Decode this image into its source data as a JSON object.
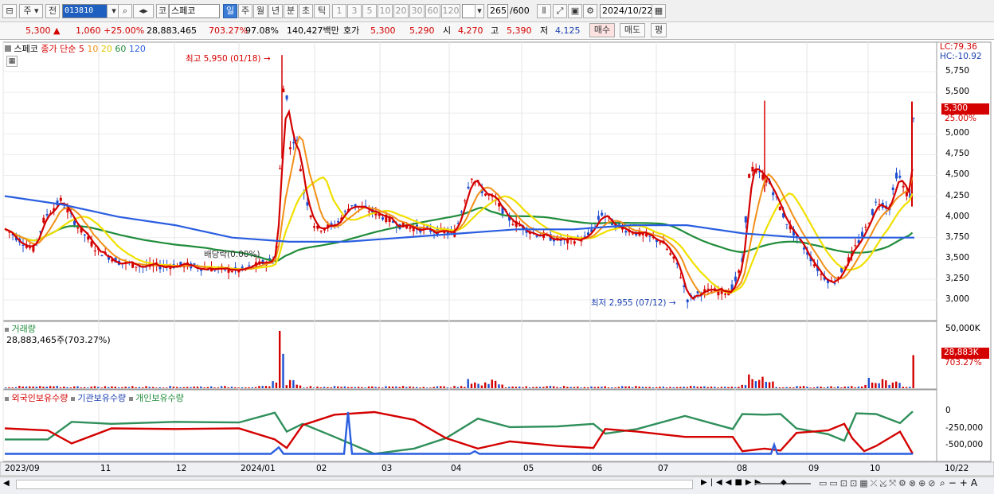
{
  "toolbar": {
    "market": "주",
    "prev_btn": "전",
    "code": "013810",
    "name_prefix": "코",
    "name": "스페코",
    "periods": [
      "일",
      "주",
      "월",
      "년",
      "분",
      "초",
      "틱"
    ],
    "minutes": [
      "1",
      "3",
      "5",
      "10",
      "20",
      "30",
      "60",
      "120"
    ],
    "count": "265",
    "count_max": "/600",
    "date": "2024/10/22"
  },
  "quote": {
    "price": "5,300",
    "change": "1,060",
    "change_pct": "+25.00%",
    "volume": "28,883,465",
    "vol_ratio": "703.27%",
    "strength": "97.08%",
    "amount": "140,427백만",
    "hoga_label": "호가",
    "ask": "5,300",
    "bid": "5,290",
    "open_label": "시",
    "open": "4,270",
    "high_label": "고",
    "high": "5,390",
    "low_label": "저",
    "low": "4,125",
    "buy_btn": "매수",
    "sell_btn": "매도",
    "eval_btn": "평"
  },
  "price_panel": {
    "title": "스페코",
    "legend": [
      {
        "label": "종가 단순",
        "color": "#d40000"
      },
      {
        "label": "5",
        "color": "#d40000"
      },
      {
        "label": "10",
        "color": "#f29018"
      },
      {
        "label": "20",
        "color": "#f0e000"
      },
      {
        "label": "60",
        "color": "#1f8c3a"
      },
      {
        "label": "120",
        "color": "#2a5ee0"
      }
    ],
    "lc": "LC:79.36",
    "hc": "HC:-10.92",
    "y_ticks": [
      "5,750",
      "5,500",
      "5,250",
      "5,000",
      "4,750",
      "4,500",
      "4,250",
      "4,000",
      "3,750",
      "3,500",
      "3,250",
      "3,000"
    ],
    "current_label": "5,300",
    "current_pct": "25.00%",
    "high_note": "최고 5,950 (01/18)",
    "low_note": "최저 2,955 (07/12)",
    "dividend_note": "배당락(0.00%)"
  },
  "volume_panel": {
    "title": "거래량",
    "value": "28,883,465주(703.27%)",
    "y_max": "50,000K",
    "current_label": "28,883K",
    "current_pct": "703.27%"
  },
  "holding_panel": {
    "legend": [
      {
        "label": "외국인보유수량",
        "color": "#d40000"
      },
      {
        "label": "기관보유수량",
        "color": "#1a3fb0"
      },
      {
        "label": "개인보유수량",
        "color": "#1f8c3a"
      }
    ],
    "y_ticks": [
      "0",
      "-250,000",
      "-500,000"
    ]
  },
  "x_axis": {
    "labels": [
      "2023/09",
      "11",
      "12",
      "2024/01",
      "02",
      "03",
      "04",
      "05",
      "06",
      "07",
      "08",
      "09",
      "10"
    ],
    "end_label": "10/22"
  },
  "chart_data": [
    {
      "type": "line",
      "title": "스페코",
      "x": [
        "2023/09",
        "2023/10",
        "2023/11",
        "2023/12",
        "2024/01",
        "2024/01/18",
        "2024/02",
        "2024/03",
        "2024/04",
        "2024/05",
        "2024/06",
        "2024/07",
        "2024/07/12",
        "2024/08",
        "2024/09",
        "2024/10",
        "2024/10/22"
      ],
      "series": [
        {
          "name": "종가",
          "values": [
            3850,
            4200,
            3500,
            3400,
            3350,
            5950,
            3800,
            4050,
            4500,
            3850,
            3750,
            3700,
            2955,
            4600,
            3300,
            4500,
            5300
          ]
        },
        {
          "name": "120",
          "values": [
            4250,
            4150,
            4000,
            3900,
            3750,
            3700,
            3700,
            3750,
            3800,
            3850,
            3850,
            3900,
            3900,
            3800,
            3750,
            3750,
            3750
          ]
        }
      ],
      "ylim": [
        2800,
        6000
      ],
      "grid": true
    },
    {
      "type": "bar",
      "title": "거래량",
      "categories": [
        "2023/10",
        "2024/01",
        "2024/04",
        "2024/08",
        "2024/10/22"
      ],
      "values": [
        5000,
        50000,
        8000,
        12000,
        28883
      ],
      "ylim": [
        0,
        50000
      ]
    }
  ],
  "status_icons": [
    "scroll-right",
    "scroll-first",
    "scroll-prev",
    "stop",
    "scroll-next",
    "zoom-out",
    "zoom-in"
  ]
}
